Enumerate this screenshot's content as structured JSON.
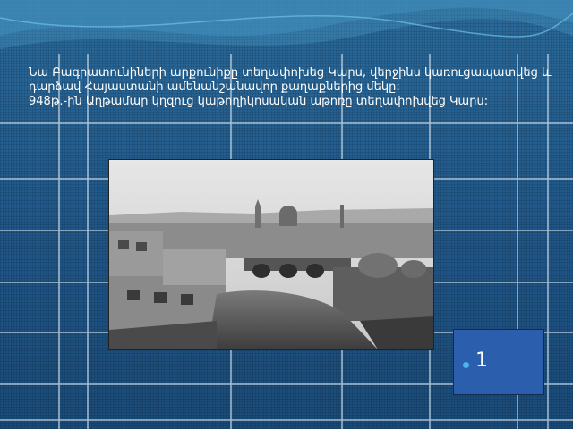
{
  "slide": {
    "body_text": "Նա  Բագրատունիների արքունիքը տեղափոխեց  Կարս,  վերջինս կառուցապատվեց  և   դարձավ  Հայաստանի ամենանշանավոր քաղաքներից  մեկը:\n948թ.-ին Աղթամար կղզուց  կաթողիկոսական աթոռը  տեղափոխվեց Կարս:",
    "caption_label": "1",
    "photo_icon": "historic-city-photo"
  },
  "colors": {
    "background": "#1e4f7e",
    "caption_box": "#2b5fae",
    "bullet": "#4fb3e8",
    "text": "#ffffff"
  }
}
